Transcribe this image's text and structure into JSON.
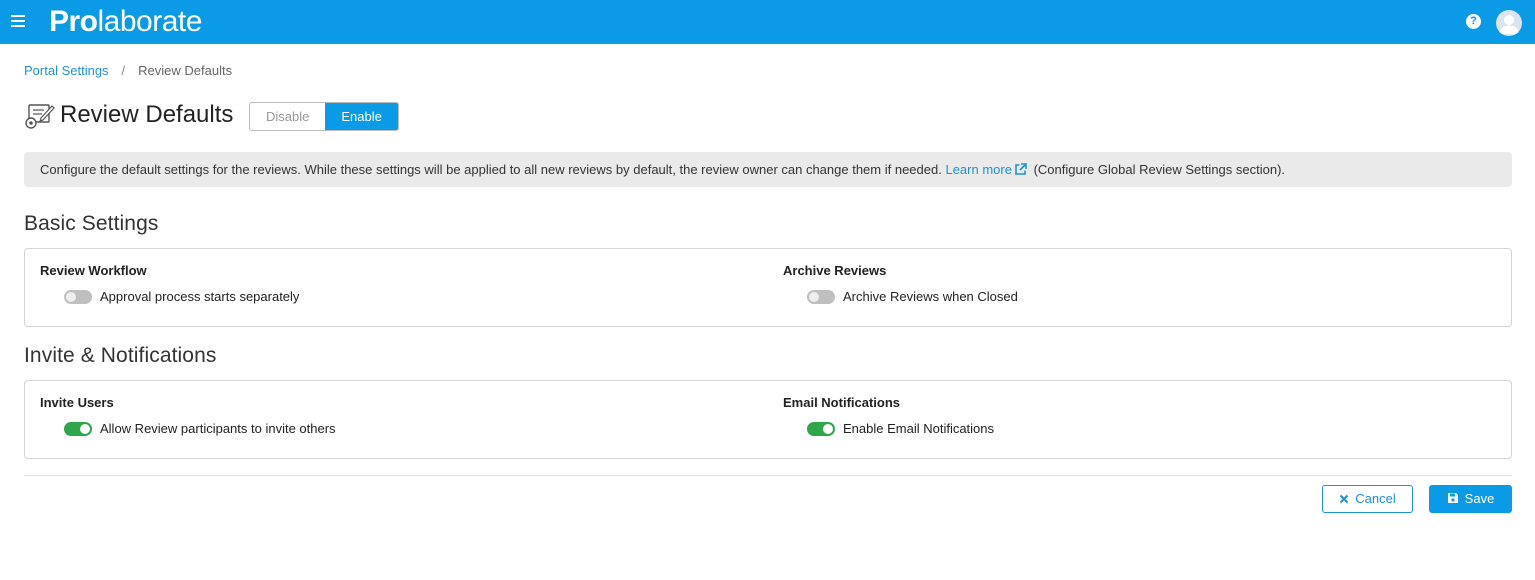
{
  "header": {
    "brand_bold": "Pro",
    "brand_rest": "laborate",
    "menu_icon": "hamburger-icon",
    "help_icon": "help-icon",
    "help_glyph": "?",
    "avatar_icon": "user-avatar-icon",
    "brand_color": "#0b9be6"
  },
  "breadcrumb": {
    "parent": "Portal Settings",
    "separator": "/",
    "current": "Review Defaults"
  },
  "page": {
    "title": "Review Defaults",
    "title_icon": "review-settings-icon",
    "disable_label": "Disable",
    "enable_label": "Enable",
    "active_state": "Enable"
  },
  "info": {
    "text": "Configure the default settings for the reviews. While these settings will be applied to all new reviews by default, the review owner can change them if needed.",
    "link_label": "Learn more",
    "link_icon": "external-link-icon",
    "suffix": "(Configure Global Review Settings section)."
  },
  "basic_settings": {
    "title": "Basic Settings",
    "review_workflow": {
      "label": "Review Workflow",
      "toggle_label": "Approval process starts separately",
      "enabled": false
    },
    "archive_reviews": {
      "label": "Archive Reviews",
      "toggle_label": "Archive Reviews when Closed",
      "enabled": false
    }
  },
  "invite_notifications": {
    "title": "Invite & Notifications",
    "invite_users": {
      "label": "Invite Users",
      "toggle_label": "Allow Review participants to invite others",
      "enabled": true
    },
    "email_notifications": {
      "label": "Email Notifications",
      "toggle_label": "Enable Email Notifications",
      "enabled": true
    }
  },
  "actions": {
    "cancel_label": "Cancel",
    "cancel_icon": "close-icon",
    "save_label": "Save",
    "save_icon": "save-icon"
  },
  "colors": {
    "accent": "#0b9be6",
    "link": "#1d92d6",
    "toggle_on": "#2ea64a",
    "toggle_off": "#bfbfbf"
  }
}
